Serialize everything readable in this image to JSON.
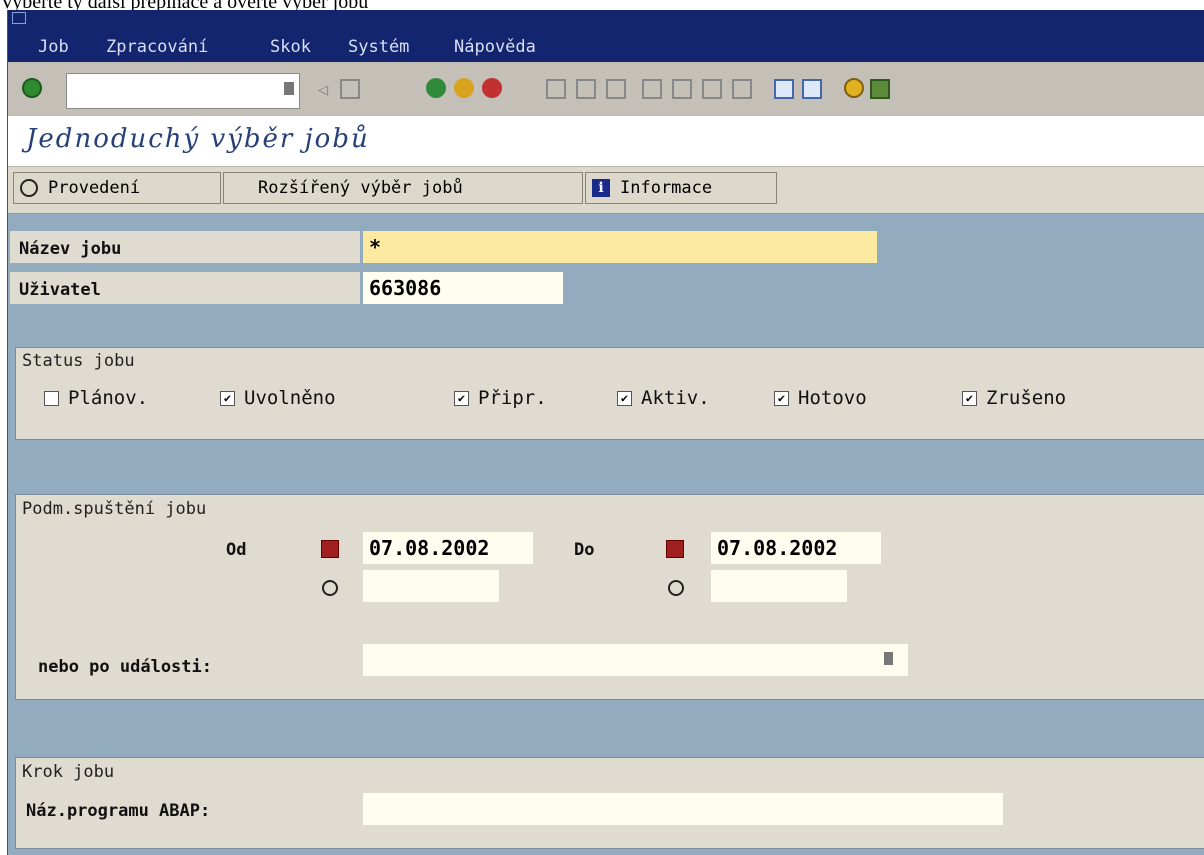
{
  "top_text": "Vyberte ty další přepínače a ověřte výběr jobů",
  "menu": [
    "Job",
    "Zpracování",
    "Skok",
    "Systém",
    "Nápověda"
  ],
  "title": "Jednoduchý výběr jobů",
  "app_toolbar": {
    "execute": "Provedení",
    "extended": "Rozšířený výběr jobů",
    "info": "Informace"
  },
  "fields": {
    "job_name_label": "Název jobu",
    "job_name_value": "*",
    "user_label": "Uživatel",
    "user_value": "663086"
  },
  "status_group": {
    "title": "Status jobu",
    "items": [
      {
        "label": "Plánov.",
        "checked": false
      },
      {
        "label": "Uvolněno",
        "checked": true
      },
      {
        "label": "Připr.",
        "checked": true
      },
      {
        "label": "Aktiv.",
        "checked": true
      },
      {
        "label": "Hotovo",
        "checked": true
      },
      {
        "label": "Zrušeno",
        "checked": true
      }
    ]
  },
  "start_group": {
    "title": "Podm.spuštění jobu",
    "from_label": "Od",
    "from_date": "07.08.2002",
    "to_label": "Do",
    "to_date": "07.08.2002",
    "event_label": "nebo po události:"
  },
  "step_group": {
    "title": "Krok jobu",
    "program_label": "Náz.programu ABAP:"
  },
  "colors": {
    "menubar": "#12256e",
    "background": "#93abbf",
    "group": "#e0dbd0",
    "required_field": "#fbeaa0",
    "title": "#27407a"
  }
}
